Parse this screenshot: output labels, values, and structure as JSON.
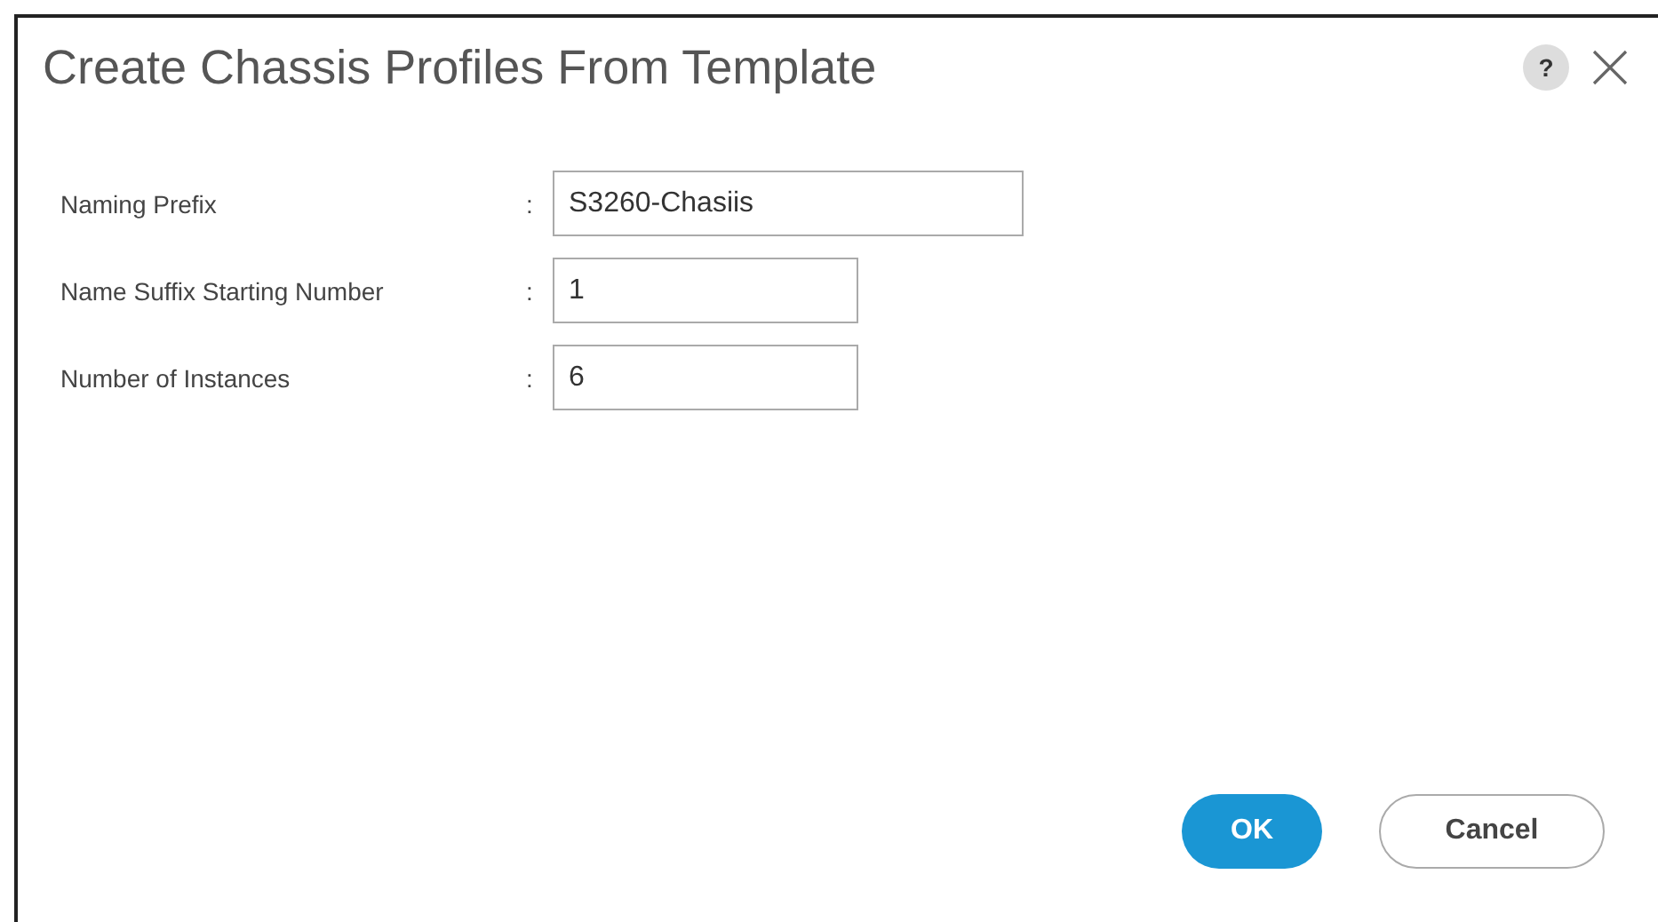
{
  "dialog": {
    "title": "Create Chassis Profiles From Template",
    "help": "?"
  },
  "fields": [
    {
      "label": "Naming Prefix",
      "separator": ":",
      "value": "S3260-Chasiis",
      "wide": true
    },
    {
      "label": "Name Suffix Starting Number",
      "separator": ":",
      "value": "1",
      "wide": false
    },
    {
      "label": "Number of Instances",
      "separator": ":",
      "value": "6",
      "wide": false
    }
  ],
  "buttons": [
    {
      "label": "OK",
      "kind": "primary"
    },
    {
      "label": "Cancel",
      "kind": "secondary"
    }
  ]
}
